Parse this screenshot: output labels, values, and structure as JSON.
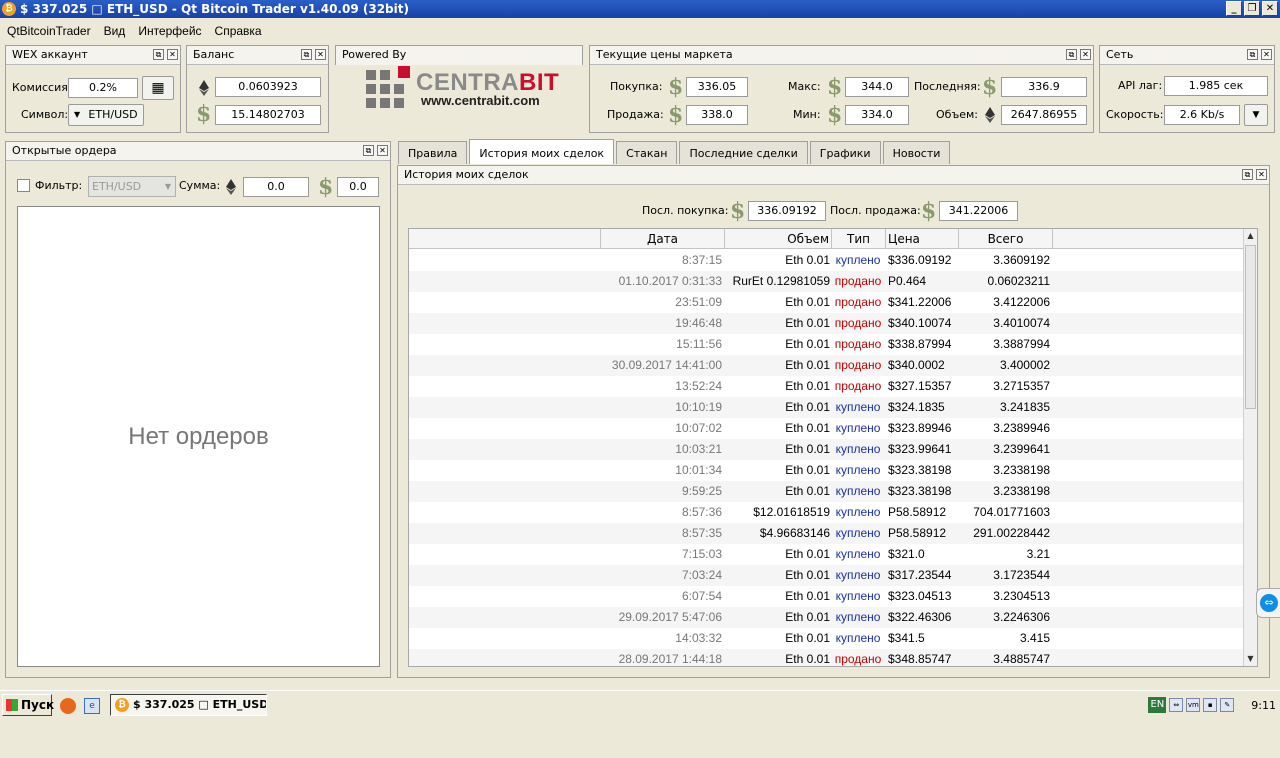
{
  "window": {
    "title": "$ 337.025 □ ETH_USD - Qt Bitcoin Trader v1.40.09 (32bit)",
    "icon": "bitcoin-icon"
  },
  "menu": [
    "QtBitcoinTrader",
    "Вид",
    "Интерфейс",
    "Справка"
  ],
  "account": {
    "title": "WEX аккаунт",
    "fee_label": "Комиссия:",
    "fee_value": "0.2%",
    "symbol_label": "Символ:",
    "symbol_value": "ETH/USD"
  },
  "balance": {
    "title": "Баланс",
    "eth_value": "0.0603923",
    "usd_value": "15.14802703"
  },
  "powered": {
    "title": "Powered By",
    "logo_text": "CENTRA",
    "logo_text_bold": "BIT",
    "logo_url": "www.centrabit.com"
  },
  "market": {
    "title": "Текущие цены маркета",
    "buy_label": "Покупка:",
    "buy_value": "336.05",
    "sell_label": "Продажа:",
    "sell_value": "338.0",
    "max_label": "Макс:",
    "max_value": "344.0",
    "min_label": "Мин:",
    "min_value": "334.0",
    "last_label": "Последняя:",
    "last_value": "336.9",
    "volume_label": "Объем:",
    "volume_value": "2647.86955"
  },
  "network": {
    "title": "Сеть",
    "lag_label": "API лаг:",
    "lag_value": "1.985 сек",
    "speed_label": "Скорость:",
    "speed_value": "2.6 Kb/s"
  },
  "orders": {
    "title": "Открытые ордера",
    "filter_label": "Фильтр:",
    "filter_value": "ETH/USD",
    "sum_label": "Сумма:",
    "sum_eth": "0.0",
    "sum_usd": "0.0",
    "empty_text": "Нет ордеров"
  },
  "tabs": [
    "Правила",
    "История моих сделок",
    "Стакан",
    "Последние сделки",
    "Графики",
    "Новости"
  ],
  "history": {
    "title": "История моих сделок",
    "last_buy_label": "Посл. покупка:",
    "last_buy_value": "336.09192",
    "last_sell_label": "Посл. продажа:",
    "last_sell_value": "341.22006",
    "columns": [
      "Дата",
      "Объем",
      "Тип",
      "Цена",
      "Всего"
    ],
    "rows": [
      {
        "date": "8:37:15",
        "vol": "Eth 0.01",
        "type": "куплено",
        "price": "$336.09192",
        "total": "3.3609192"
      },
      {
        "date": "01.10.2017 0:31:33",
        "vol": "RurEt 0.12981059",
        "type": "продано",
        "price": "P0.464",
        "total": "0.06023211"
      },
      {
        "date": "23:51:09",
        "vol": "Eth 0.01",
        "type": "продано",
        "price": "$341.22006",
        "total": "3.4122006"
      },
      {
        "date": "19:46:48",
        "vol": "Eth 0.01",
        "type": "продано",
        "price": "$340.10074",
        "total": "3.4010074"
      },
      {
        "date": "15:11:56",
        "vol": "Eth 0.01",
        "type": "продано",
        "price": "$338.87994",
        "total": "3.3887994"
      },
      {
        "date": "30.09.2017 14:41:00",
        "vol": "Eth 0.01",
        "type": "продано",
        "price": "$340.0002",
        "total": "3.400002"
      },
      {
        "date": "13:52:24",
        "vol": "Eth 0.01",
        "type": "продано",
        "price": "$327.15357",
        "total": "3.2715357"
      },
      {
        "date": "10:10:19",
        "vol": "Eth 0.01",
        "type": "куплено",
        "price": "$324.1835",
        "total": "3.241835"
      },
      {
        "date": "10:07:02",
        "vol": "Eth 0.01",
        "type": "куплено",
        "price": "$323.89946",
        "total": "3.2389946"
      },
      {
        "date": "10:03:21",
        "vol": "Eth 0.01",
        "type": "куплено",
        "price": "$323.99641",
        "total": "3.2399641"
      },
      {
        "date": "10:01:34",
        "vol": "Eth 0.01",
        "type": "куплено",
        "price": "$323.38198",
        "total": "3.2338198"
      },
      {
        "date": "9:59:25",
        "vol": "Eth 0.01",
        "type": "куплено",
        "price": "$323.38198",
        "total": "3.2338198"
      },
      {
        "date": "8:57:36",
        "vol": "$12.01618519",
        "type": "куплено",
        "price": "P58.58912",
        "total": "704.01771603"
      },
      {
        "date": "8:57:35",
        "vol": "$4.96683146",
        "type": "куплено",
        "price": "P58.58912",
        "total": "291.00228442"
      },
      {
        "date": "7:15:03",
        "vol": "Eth 0.01",
        "type": "куплено",
        "price": "$321.0",
        "total": "3.21"
      },
      {
        "date": "7:03:24",
        "vol": "Eth 0.01",
        "type": "куплено",
        "price": "$317.23544",
        "total": "3.1723544"
      },
      {
        "date": "6:07:54",
        "vol": "Eth 0.01",
        "type": "куплено",
        "price": "$323.04513",
        "total": "3.2304513"
      },
      {
        "date": "29.09.2017 5:47:06",
        "vol": "Eth 0.01",
        "type": "куплено",
        "price": "$322.46306",
        "total": "3.2246306"
      },
      {
        "date": "14:03:32",
        "vol": "Eth 0.01",
        "type": "куплено",
        "price": "$341.5",
        "total": "3.415"
      },
      {
        "date": "28.09.2017 1:44:18",
        "vol": "Eth 0.01",
        "type": "продано",
        "price": "$348.85747",
        "total": "3.4885747"
      }
    ]
  },
  "colors": {
    "buy": "#1a2fa8",
    "sell": "#c00000",
    "dollar": "#8a9a6c"
  },
  "taskbar": {
    "start_label": "Пуск",
    "task_label": "$ 337.025 □ ETH_USD...",
    "lang": "EN",
    "clock": "9:11"
  }
}
